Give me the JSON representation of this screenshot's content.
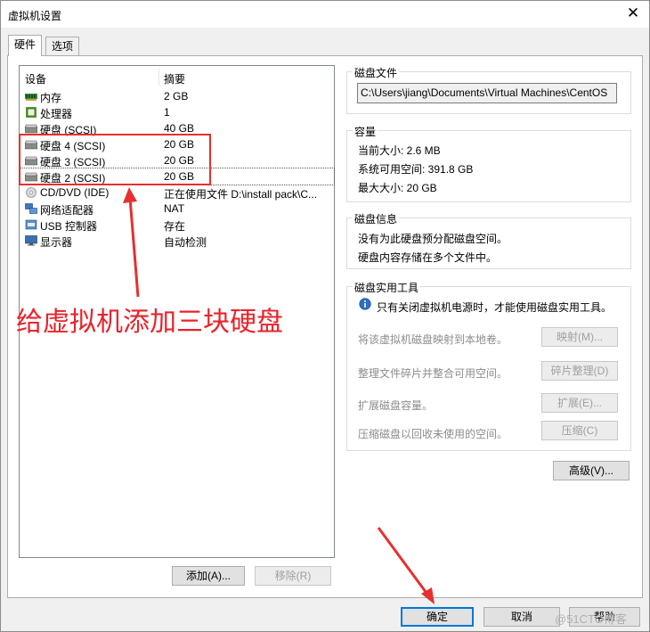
{
  "window": {
    "title": "虚拟机设置",
    "close_glyph": "✕"
  },
  "tabs": [
    {
      "label": "硬件",
      "active": true
    },
    {
      "label": "选项",
      "active": false
    }
  ],
  "device_list": {
    "columns": [
      "设备",
      "摘要"
    ],
    "rows": [
      {
        "icon": "memory-icon",
        "name": "内存",
        "summary": "2 GB"
      },
      {
        "icon": "processor-icon",
        "name": "处理器",
        "summary": "1"
      },
      {
        "icon": "harddisk-icon",
        "name": "硬盘 (SCSI)",
        "summary": "40 GB"
      },
      {
        "icon": "harddisk-icon",
        "name": "硬盘 4 (SCSI)",
        "summary": "20 GB"
      },
      {
        "icon": "harddisk-icon",
        "name": "硬盘 3 (SCSI)",
        "summary": "20 GB"
      },
      {
        "icon": "harddisk-icon",
        "name": "硬盘 2 (SCSI)",
        "summary": "20 GB",
        "selected": true
      },
      {
        "icon": "cd-dvd-icon",
        "name": "CD/DVD (IDE)",
        "summary": "正在使用文件 D:\\install pack\\C..."
      },
      {
        "icon": "network-adapter-icon",
        "name": "网络适配器",
        "summary": "NAT"
      },
      {
        "icon": "usb-controller-icon",
        "name": "USB 控制器",
        "summary": "存在"
      },
      {
        "icon": "display-icon",
        "name": "显示器",
        "summary": "自动检测"
      }
    ],
    "add_button": "添加(A)...",
    "remove_button": "移除(R)"
  },
  "disk_file": {
    "title": "磁盘文件",
    "path": "C:\\Users\\jiang\\Documents\\Virtual Machines\\CentOS"
  },
  "capacity": {
    "title": "容量",
    "current_size": "当前大小: 2.6 MB",
    "available_space": "系统可用空间: 391.8 GB",
    "max_size": "最大大小: 20 GB"
  },
  "disk_info": {
    "title": "磁盘信息",
    "line1": "没有为此硬盘预分配磁盘空间。",
    "line2": "硬盘内容存储在多个文件中。"
  },
  "disk_utilities": {
    "title": "磁盘实用工具",
    "info": "只有关闭虚拟机电源时，才能使用磁盘实用工具。",
    "map_desc": "将该虚拟机磁盘映射到本地卷。",
    "map_button": "映射(M)...",
    "defrag_desc": "整理文件碎片并整合可用空间。",
    "defrag_button": "碎片整理(D)",
    "expand_desc": "扩展磁盘容量。",
    "expand_button": "扩展(E)...",
    "compact_desc": "压缩磁盘以回收未使用的空间。",
    "compact_button": "压缩(C)"
  },
  "advanced_button": "高级(V)...",
  "footer": {
    "ok": "确定",
    "cancel": "取消",
    "help": "帮助"
  },
  "annotation": {
    "text": "给虚拟机添加三块硬盘",
    "color": "#e8232b"
  },
  "watermark": "@51CTO博客"
}
